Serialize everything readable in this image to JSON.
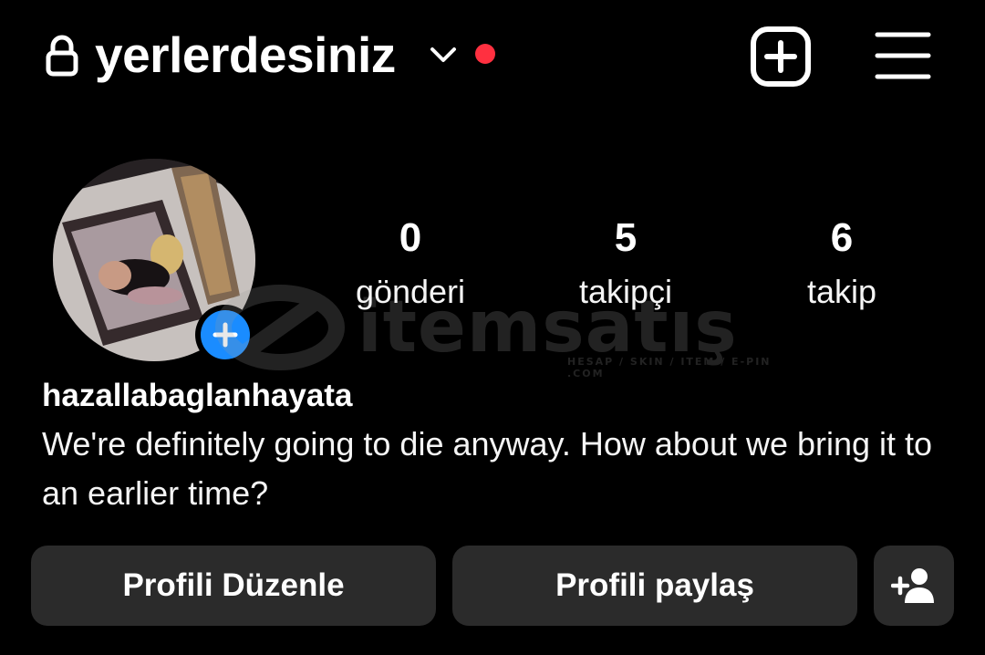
{
  "header": {
    "username": "yerlerdesiniz",
    "lock_icon": "lock-icon",
    "chevron_icon": "chevron-down-icon",
    "notification_dot_color": "#ff3040",
    "create_icon": "plus-square-icon",
    "menu_icon": "hamburger-menu-icon"
  },
  "profile": {
    "avatar_icon": "avatar",
    "add_story_icon": "plus-icon",
    "add_story_color": "#1a8cff",
    "stats": {
      "posts": {
        "value": "0",
        "label": "gönderi"
      },
      "followers": {
        "value": "5",
        "label": "takipçi"
      },
      "following": {
        "value": "6",
        "label": "takip"
      }
    },
    "display_name": "hazallabaglanhayata",
    "bio": "We're definitely going to die anyway. How about we bring it to an earlier time?"
  },
  "actions": {
    "edit_profile": "Profili Düzenle",
    "share_profile": "Profili paylaş",
    "discover_people_icon": "add-person-icon"
  },
  "watermark": {
    "text": "itemsatış",
    "subtitle": "HESAP / SKIN / ITEM / E-PIN .COM"
  }
}
